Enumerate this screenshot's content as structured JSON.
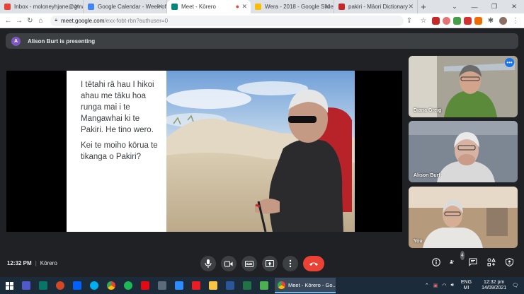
{
  "browser": {
    "tabs": [
      {
        "title": "Inbox - moloneyhjane@gmail",
        "favicon_color": "#ea4335",
        "active": false
      },
      {
        "title": "Google Calendar - Week of 1",
        "favicon_color": "#4285f4",
        "active": false
      },
      {
        "title": "Meet - Kōrero",
        "favicon_color": "#00897b",
        "active": true
      },
      {
        "title": "Wera - 2018 - Google Slides",
        "favicon_color": "#fbbc04",
        "active": false
      },
      {
        "title": "pakiri - Māori Dictionary",
        "favicon_color": "#c62828",
        "active": false
      }
    ],
    "new_tab": "+",
    "url_host": "meet.google.com",
    "url_path": "/exx-fobt-rbn?authuser=0"
  },
  "banner": {
    "avatar_letter": "A",
    "text": "Alison Burt is presenting"
  },
  "slide": {
    "paragraph1": "I tētahi rā hau I hikoi ahau me tāku hoa runga mai i te Mangawhai ki te Pakiri. He tino wero.",
    "paragraph2": "Kei te moiho kōrua te tikanga o Pakiri?"
  },
  "participants": [
    {
      "name": "Diana Greig"
    },
    {
      "name": "Alison Burt"
    },
    {
      "name": "You"
    }
  ],
  "meeting": {
    "time": "12:32 PM",
    "title": "Kōrero",
    "people_count": "4"
  },
  "taskbar": {
    "active_task": "Meet - Kōrero - Go...",
    "lang_line1": "ENG",
    "lang_line2": "MI",
    "time": "12:32 pm",
    "date": "14/09/2021"
  },
  "colors": {
    "end_call": "#ea4335",
    "accent": "#1a73e8"
  }
}
